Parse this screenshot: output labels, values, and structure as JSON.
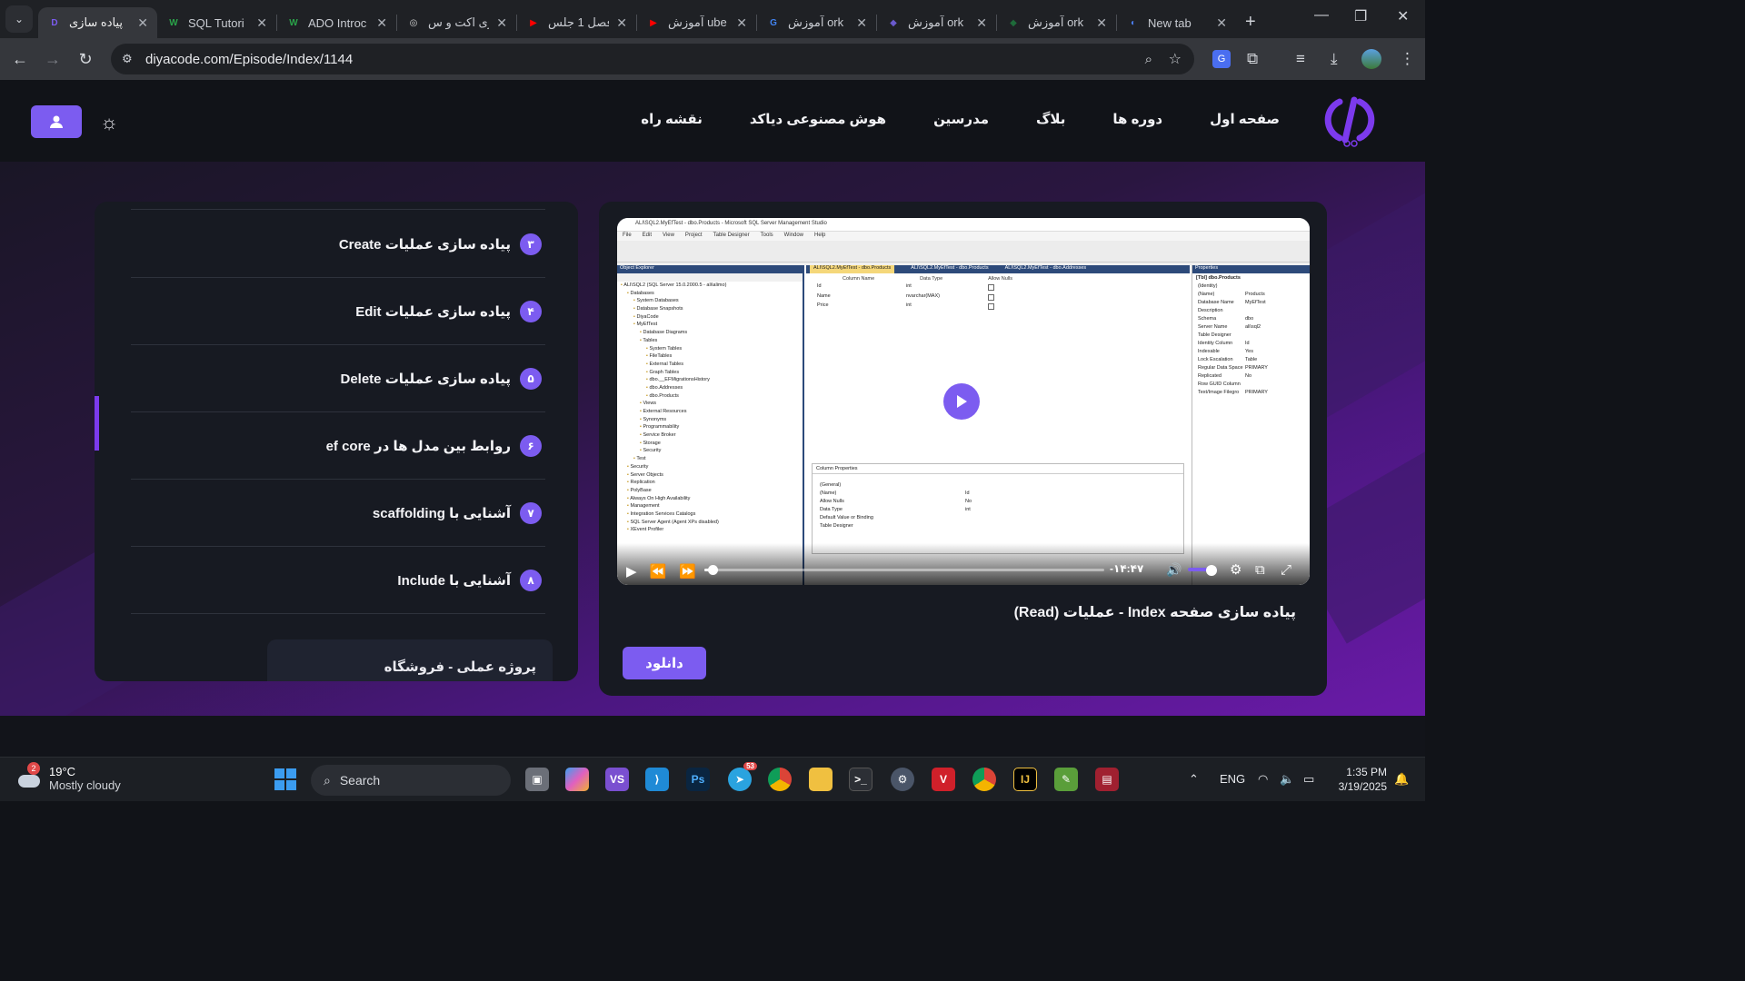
{
  "browser": {
    "tabs": [
      {
        "label": "پیاده سازی",
        "favicon": "D",
        "fav_color": "#7c5cf0",
        "active": true
      },
      {
        "label": "SQL Tutori",
        "favicon": "W",
        "fav_color": "#2aa44a",
        "active": false
      },
      {
        "label": "ADO Introc",
        "favicon": "W",
        "fav_color": "#2aa44a",
        "active": false
      },
      {
        "label": "ری اکت و س",
        "favicon": "◎",
        "fav_color": "#d8d8d8",
        "active": false
      },
      {
        "label": "فصل 1 جلس",
        "favicon": "▶",
        "fav_color": "#ff0000",
        "active": false
      },
      {
        "label": "آموزش ube",
        "favicon": "▶",
        "fav_color": "#ff0000",
        "active": false
      },
      {
        "label": "آموزش ork",
        "favicon": "G",
        "fav_color": "#4285f4",
        "active": false
      },
      {
        "label": "آموزش ork",
        "favicon": "◆",
        "fav_color": "#6a5acd",
        "active": false
      },
      {
        "label": "آموزش ork",
        "favicon": "◆",
        "fav_color": "#1e6b3a",
        "active": false
      },
      {
        "label": "New tab",
        "favicon": "◐",
        "fav_color": "#4a7df0",
        "active": false
      }
    ],
    "url": "diyacode.com/Episode/Index/1144"
  },
  "site": {
    "nav": [
      "صفحه اول",
      "دوره ها",
      "بلاگ",
      "مدرسین",
      "هوش مصنوعی دیاکد",
      "نقشه راه"
    ]
  },
  "lessons": [
    {
      "num": "۳",
      "title": "پیاده سازی عملیات Create"
    },
    {
      "num": "۴",
      "title": "پیاده سازی عملیات Edit"
    },
    {
      "num": "۵",
      "title": "پیاده سازی عملیات Delete"
    },
    {
      "num": "۶",
      "title": "روابط بین مدل ها در ef core"
    },
    {
      "num": "۷",
      "title": "آشنایی با scaffolding"
    },
    {
      "num": "۸",
      "title": "آشنایی با Include"
    }
  ],
  "section_title": "پروژه عملی - فروشگاه",
  "video": {
    "ssms_title": "ALI\\SQL2.MyEfTest - dbo.Products - Microsoft SQL Server Management Studio",
    "ssms_menu": [
      "File",
      "Edit",
      "View",
      "Project",
      "Table Designer",
      "Tools",
      "Window",
      "Help"
    ],
    "object_explorer_title": "Object Explorer",
    "object_explorer": [
      "ALI\\SQL2 (SQL Server 15.0.2000.5 - ali\\alimo)",
      "Databases",
      "System Databases",
      "Database Snapshots",
      "DiyaCode",
      "MyEfTest",
      "Database Diagrams",
      "Tables",
      "System Tables",
      "FileTables",
      "External Tables",
      "Graph Tables",
      "dbo.__EFMigrationsHistory",
      "dbo.Addresses",
      "dbo.Products",
      "Views",
      "External Resources",
      "Synonyms",
      "Programmability",
      "Service Broker",
      "Storage",
      "Security",
      "Test",
      "Security",
      "Server Objects",
      "Replication",
      "PolyBase",
      "Always On High Availability",
      "Management",
      "Integration Services Catalogs",
      "SQL Server Agent (Agent XPs disabled)",
      "XEvent Profiler"
    ],
    "doc_tabs": [
      "ALI\\SQL2.MyEfTest - dbo.Products",
      "ALI\\SQL2.MyEfTest - dbo.Products",
      "ALI\\SQL2.MyEfTest - dbo.Addresses"
    ],
    "grid_headers": [
      "Column Name",
      "Data Type",
      "Allow Nulls"
    ],
    "grid_rows": [
      {
        "name": "Id",
        "type": "int"
      },
      {
        "name": "Name",
        "type": "nvarchar(MAX)"
      },
      {
        "name": "Price",
        "type": "int"
      }
    ],
    "column_properties_title": "Column Properties",
    "column_properties": [
      {
        "k": "(General)",
        "v": ""
      },
      {
        "k": "(Name)",
        "v": "Id"
      },
      {
        "k": "Allow Nulls",
        "v": "No"
      },
      {
        "k": "Data Type",
        "v": "int"
      },
      {
        "k": "Default Value or Binding",
        "v": ""
      },
      {
        "k": "Table Designer",
        "v": ""
      }
    ],
    "properties_title": "Properties",
    "properties_object": "[Tbl] dbo.Products",
    "properties": [
      {
        "k": "(Identity)",
        "v": ""
      },
      {
        "k": "(Name)",
        "v": "Products"
      },
      {
        "k": "Database Name",
        "v": "MyEfTest"
      },
      {
        "k": "Description",
        "v": ""
      },
      {
        "k": "Schema",
        "v": "dbo"
      },
      {
        "k": "Server Name",
        "v": "ali\\sql2"
      },
      {
        "k": "Table Designer",
        "v": ""
      },
      {
        "k": "Identity Column",
        "v": "Id"
      },
      {
        "k": "Indexable",
        "v": "Yes"
      },
      {
        "k": "Lock Escalation",
        "v": "Table"
      },
      {
        "k": "Regular Data Space",
        "v": "PRIMARY"
      },
      {
        "k": "Replicated",
        "v": "No"
      },
      {
        "k": "Row GUID Column",
        "v": ""
      },
      {
        "k": "Text/Image Filegro",
        "v": "PRIMARY"
      }
    ],
    "time_remaining": "-۱۴:۴۷",
    "progress": 0.02,
    "volume": 0.8
  },
  "episode_title": "پیاده سازی صفحه Index - عملیات (Read)",
  "download_label": "دانلود",
  "taskbar": {
    "temp": "19°C",
    "weather": "Mostly cloudy",
    "weather_badge": "2",
    "search": "Search",
    "lang": "ENG",
    "time": "1:35 PM",
    "date": "3/19/2025",
    "telegram_badge": "53"
  },
  "colors": {
    "accent": "#7c5cf0",
    "page_bg": "#12141a"
  }
}
